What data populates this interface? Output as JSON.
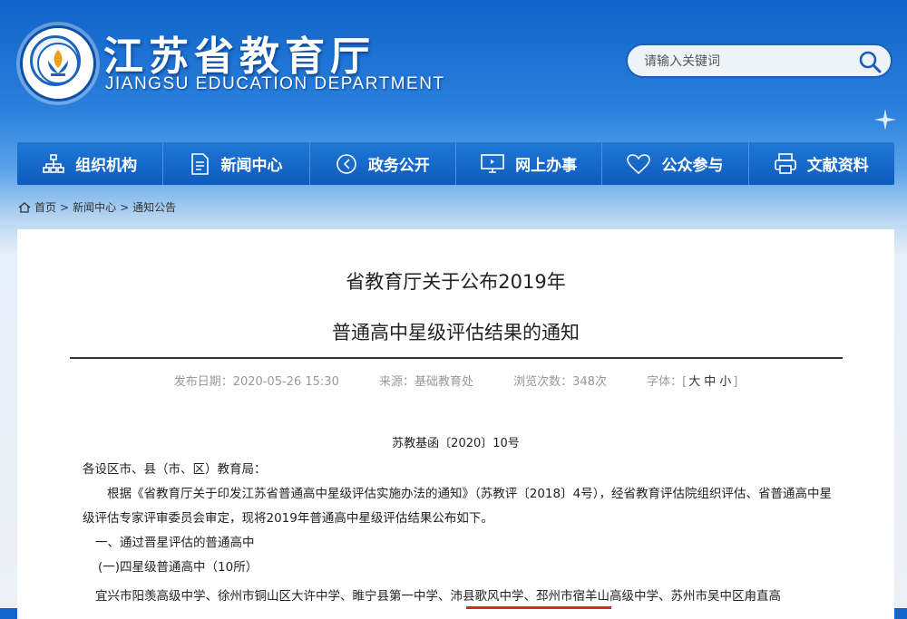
{
  "header": {
    "site_title": "江苏省教育厅",
    "site_subtitle": "JIANGSU EDUCATION DEPARTMENT",
    "search_placeholder": "请输入关键词"
  },
  "nav": [
    {
      "label": "组织机构",
      "icon": "org-chart-icon"
    },
    {
      "label": "新闻中心",
      "icon": "document-icon"
    },
    {
      "label": "政务公开",
      "icon": "compass-icon"
    },
    {
      "label": "网上办事",
      "icon": "monitor-icon"
    },
    {
      "label": "公众参与",
      "icon": "heart-icon"
    },
    {
      "label": "文献资料",
      "icon": "printer-icon"
    }
  ],
  "breadcrumb": {
    "home": "首页",
    "news": "新闻中心",
    "current": "通知公告",
    "sep": ">"
  },
  "article": {
    "title_line1": "省教育厅关于公布2019年",
    "title_line2": "普通高中星级评估结果的通知",
    "published": "发布日期：2020-05-26 15:30",
    "source": "来源：基础教育处",
    "views": "浏览次数：348次",
    "font_size_label": "字体：[",
    "font_large": "大",
    "font_medium": "中",
    "font_small": "小",
    "font_close": "]",
    "doc_number": "苏教基函〔2020〕10号",
    "salutation": "各设区市、县（市、区）教育局：",
    "para1": "根据《省教育厅关于印发江苏省普通高中星级评估实施办法的通知》（苏教评〔2018〕4号），经省教育评估院组织评估、省普通高中星级评估专家评审委员会审定，现将2019年普通高中星级评估结果公布如下。",
    "section1": "一、通过晋星评估的普通高中",
    "subsection1": "(一)四星级普通高中（10所）",
    "schools_line": "宜兴市阳羡高级中学、徐州市铜山区大许中学、睢宁县第一中学、沛县歌风中学、邳州市宿羊山高级中学、苏州市吴中区甪直高"
  },
  "colors": {
    "nav_bg": "#1567c9",
    "accent_underline": "#e0241b"
  }
}
